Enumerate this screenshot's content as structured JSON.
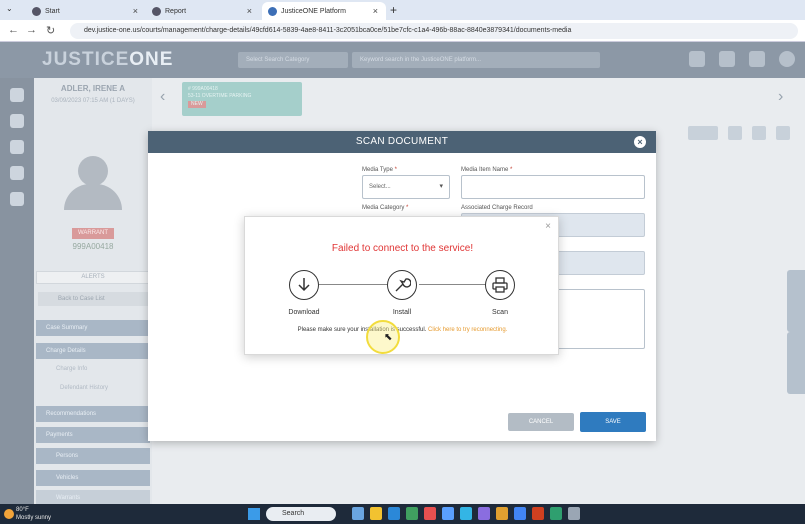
{
  "browser": {
    "tabs": [
      {
        "label": "Start",
        "active": false
      },
      {
        "label": "Report",
        "active": false
      },
      {
        "label": "JusticeONE Platform",
        "active": true
      }
    ],
    "url": "dev.justice-one.us/courts/management/charge-details/49cfd614-5839-4ae8-8411-3c2051bca0ce/51be7cfc-c1a4-496b-88ac-8840e3879341/documents-media"
  },
  "app": {
    "logo_a": "JUSTICE",
    "logo_b": "ONE",
    "search_category_placeholder": "Select Search Category",
    "search_placeholder": "Keyword search in the JusticeONE platform...",
    "person_name": "ADLER, IRENE A",
    "person_dob": "03/09/2023 07:15 AM (1 DAYS)",
    "warrant_badge": "WARRANT",
    "person_id": "999A00418",
    "alerts_label": "ALERTS",
    "back_label": "Back to Case List",
    "nav_items": [
      "Case Summary",
      "Charge Details",
      "Recommendations",
      "Payments",
      "Persons",
      "Vehicles",
      "Warrants",
      "State Reporting"
    ],
    "sub_items": [
      "Charge Info",
      "Defendant History"
    ],
    "persons_count": "2",
    "vehicles_count": "1",
    "charge_chip_line1": "# 999A00418",
    "charge_chip_line2": "53-11 OVERTIME PARKING",
    "charge_chip_tag": "NEW"
  },
  "modal": {
    "title": "SCAN DOCUMENT",
    "media_type_label": "Media Type",
    "media_type_value": "Select...",
    "media_item_name_label": "Media Item Name",
    "media_category_label": "Media Category",
    "assoc_charge_label": "Associated Charge Record",
    "cancel_label": "CANCEL",
    "save_label": "SAVE"
  },
  "dialog": {
    "title": "Failed to connect to the service!",
    "steps": [
      "Download",
      "Install",
      "Scan"
    ],
    "message": "Please make sure your installation is successful.",
    "link": "Click here to try reconnecting."
  },
  "taskbar": {
    "temp": "80°F",
    "condition": "Mostly sunny",
    "search": "Search"
  },
  "colors": {
    "modal_header": "#4c6275",
    "error_text": "#e03535",
    "link": "#e69a2e",
    "save_button": "#2f7bbf"
  }
}
